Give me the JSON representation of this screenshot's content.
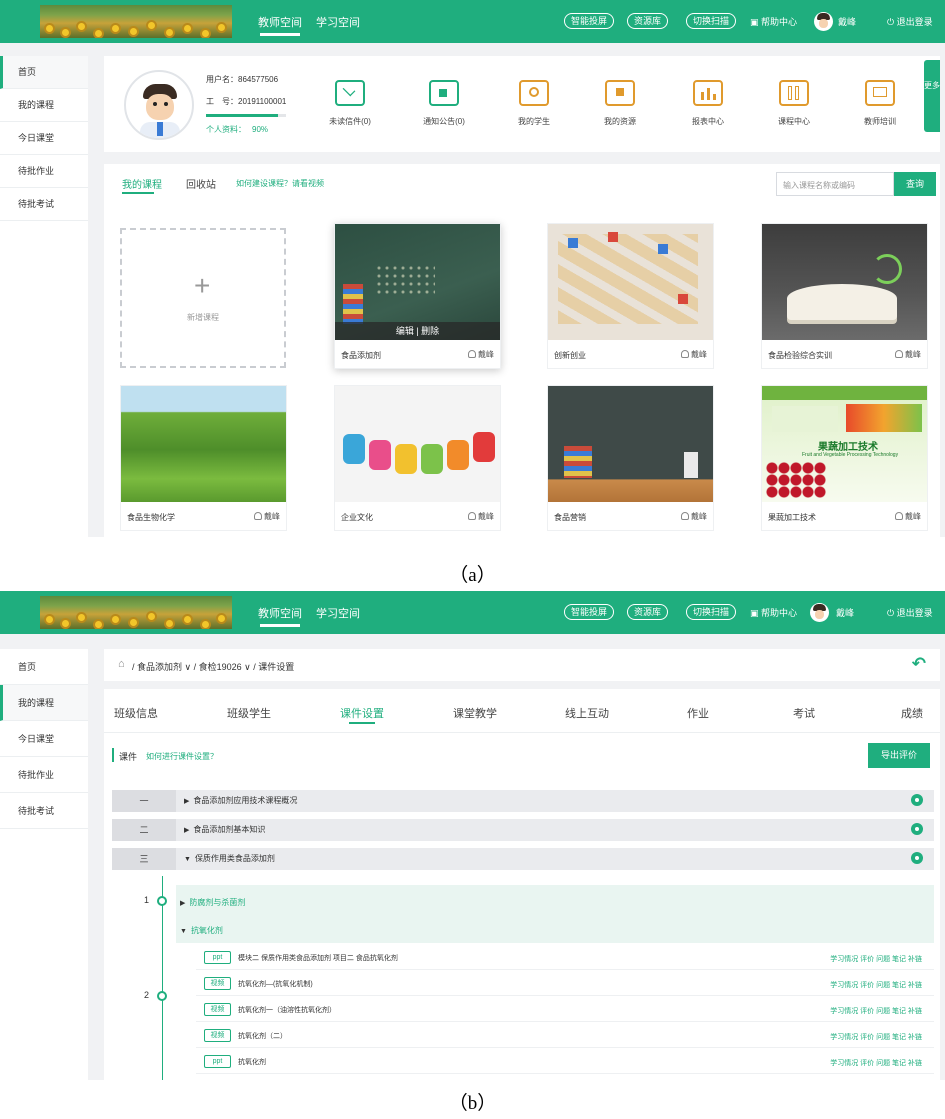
{
  "panel_a": {
    "header": {
      "nav": [
        "教师空间",
        "学习空间"
      ],
      "pills": [
        "智能投屏",
        "资源库",
        "切换扫描"
      ],
      "help": "帮助中心",
      "user": "戴峰",
      "logout": "退出登录"
    },
    "sidebar": [
      "首页",
      "我的课程",
      "今日课堂",
      "待批作业",
      "待批考试"
    ],
    "profile": {
      "username_label": "用户名：",
      "username": "864577506",
      "id_label": "工　号：",
      "id": "20191100001",
      "completeness_label": "个人资料：",
      "completeness": "90%",
      "completeness_value": 0.9
    },
    "features": [
      "未读信件(0)",
      "通知公告(0)",
      "我的学生",
      "我的资源",
      "报表中心",
      "课程中心",
      "教师培训"
    ],
    "more": "更多",
    "tabs": [
      "我的课程",
      "回收站"
    ],
    "help_link": "如何建设课程？请看视频",
    "search": {
      "placeholder": "输入课程名称或编码",
      "button": "查询"
    },
    "add_course": "新增课程",
    "course_overlay": "编辑 | 删除",
    "courses": [
      {
        "name": "食品添加剂",
        "owner": "戴峰"
      },
      {
        "name": "创新创业",
        "owner": "戴峰"
      },
      {
        "name": "食品检验综合实训",
        "owner": "戴峰"
      },
      {
        "name": "食品生物化学",
        "owner": "戴峰"
      },
      {
        "name": "企业文化",
        "owner": "戴峰"
      },
      {
        "name": "食品营销",
        "owner": "戴峰"
      },
      {
        "name": "果蔬加工技术",
        "owner": "戴峰"
      }
    ],
    "slide_title": "果蔬加工技术",
    "slide_subtitle": "Fruit and Vegetable Processing Technology",
    "caption": "（a）"
  },
  "panel_b": {
    "header": {
      "nav": [
        "教师空间",
        "学习空间"
      ],
      "pills": [
        "智能投屏",
        "资源库",
        "切换扫描"
      ],
      "help": "帮助中心",
      "user": "戴峰",
      "logout": "退出登录"
    },
    "sidebar": [
      "首页",
      "我的课程",
      "今日课堂",
      "待批作业",
      "待批考试"
    ],
    "breadcrumb": "/ 食品添加剂 ∨ / 食检19026 ∨ / 课件设置",
    "tabs": [
      "班级信息",
      "班级学生",
      "课件设置",
      "课堂教学",
      "线上互动",
      "作业",
      "考试",
      "成绩"
    ],
    "section_label": "课件",
    "section_help": "如何进行课件设置？",
    "export_button": "导出评价",
    "chapters": [
      {
        "num": "一",
        "title": "食品添加剂应用技术课程概况"
      },
      {
        "num": "二",
        "title": "食品添加剂基本知识"
      },
      {
        "num": "三",
        "title": "保质作用类食品添加剂"
      }
    ],
    "lessons": [
      {
        "num": "1",
        "title": "防腐剂与杀菌剂"
      },
      {
        "num": "2",
        "title": "抗氧化剂"
      }
    ],
    "resources": [
      {
        "tag": "ppt",
        "title": "模块二 保质作用类食品添加剂 项目二 食品抗氧化剂"
      },
      {
        "tag": "视频",
        "title": "抗氧化剂—(抗氧化机制)"
      },
      {
        "tag": "视频",
        "title": "抗氧化剂一（油溶性抗氧化剂）"
      },
      {
        "tag": "视频",
        "title": "抗氧化剂（二）"
      },
      {
        "tag": "ppt",
        "title": "抗氧化剂"
      }
    ],
    "resource_actions": "学习情况 评价 问题 笔记 补链",
    "caption": "（b）"
  }
}
